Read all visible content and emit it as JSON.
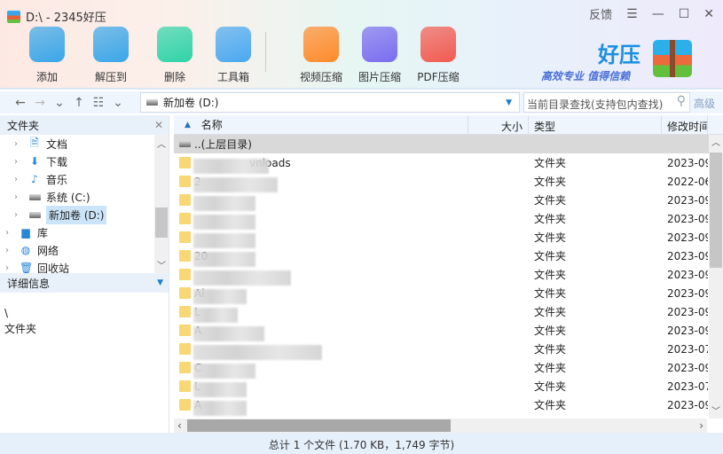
{
  "window": {
    "title": "D:\\ - 2345好压",
    "feedback": "反馈",
    "menu_icon": "hamburger-icon"
  },
  "toolbar": [
    {
      "label": "添加",
      "icon": "add-archive-icon",
      "color": "#3aa6e8"
    },
    {
      "label": "解压到",
      "icon": "extract-icon",
      "color": "#3aa6e8"
    },
    {
      "label": "删除",
      "icon": "recycle-icon",
      "color": "#2fd3a8"
    },
    {
      "label": "工具箱",
      "icon": "toolbox-icon",
      "color": "#4aa8f0"
    },
    {
      "label": "视频压缩",
      "icon": "video-compress-icon",
      "color": "#ff8a2a"
    },
    {
      "label": "图片压缩",
      "icon": "image-compress-icon",
      "color": "#7a6cf0"
    },
    {
      "label": "PDF压缩",
      "icon": "pdf-compress-icon",
      "color": "#f25a50"
    }
  ],
  "brand": {
    "name": "好压",
    "slogan": "高效专业  值得信赖"
  },
  "address": {
    "value": "新加卷 (D:)"
  },
  "search": {
    "placeholder": "当前目录查找(支持包内查找)",
    "advanced": "高级"
  },
  "left": {
    "header": "文件夹",
    "tree": [
      {
        "label": "文档",
        "icon": "document-icon"
      },
      {
        "label": "下载",
        "icon": "download-icon"
      },
      {
        "label": "音乐",
        "icon": "music-icon"
      },
      {
        "label": "系统 (C:)",
        "icon": "drive-icon"
      },
      {
        "label": "新加卷 (D:)",
        "icon": "drive-icon",
        "selected": true
      },
      {
        "label": "库",
        "icon": "library-icon"
      },
      {
        "label": "网络",
        "icon": "network-icon"
      },
      {
        "label": "回收站",
        "icon": "recycle-bin-icon"
      }
    ],
    "details_header": "详细信息",
    "details_path": "\\",
    "details_type": "文件夹"
  },
  "list": {
    "columns": [
      "名称",
      "大小",
      "类型",
      "修改时间"
    ],
    "parent": "..(上层目录)",
    "rows": [
      {
        "name": "vnloads",
        "type": "文件夹",
        "date": "2023-09"
      },
      {
        "name": "2",
        "type": "文件夹",
        "date": "2022-06"
      },
      {
        "name": "",
        "type": "文件夹",
        "date": "2023-09"
      },
      {
        "name": "",
        "type": "文件夹",
        "date": "2023-09"
      },
      {
        "name": "",
        "type": "文件夹",
        "date": "2023-09"
      },
      {
        "name": "20",
        "type": "文件夹",
        "date": "2023-09"
      },
      {
        "name": "",
        "type": "文件夹",
        "date": "2023-09"
      },
      {
        "name": "Ai",
        "type": "文件夹",
        "date": "2023-09"
      },
      {
        "name": "L",
        "type": "文件夹",
        "date": "2023-09"
      },
      {
        "name": "A",
        "type": "文件夹",
        "date": "2023-09"
      },
      {
        "name": "",
        "type": "文件夹",
        "date": "2023-07"
      },
      {
        "name": "C",
        "type": "文件夹",
        "date": "2023-09"
      },
      {
        "name": "L",
        "type": "文件夹",
        "date": "2023-07"
      },
      {
        "name": "A",
        "type": "文件夹",
        "date": "2023-09"
      }
    ]
  },
  "status": "总计 1 个文件 (1.70 KB，1,749 字节)"
}
